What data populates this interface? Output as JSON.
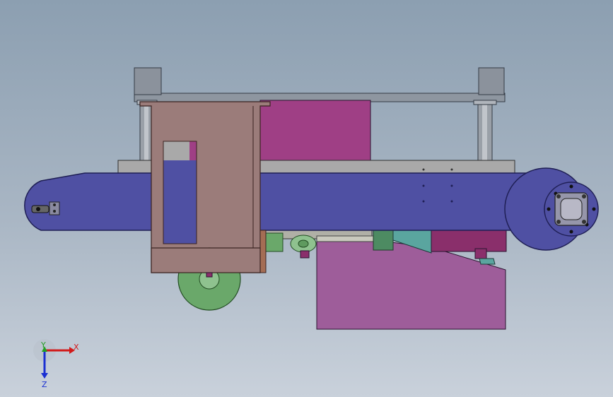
{
  "viewport": {
    "background": "#9aa9b8"
  },
  "colors": {
    "belt": "#4f50a3",
    "beltStroke": "#1f1f55",
    "bracket": "#9b7c7a",
    "panel": "#9f3f85",
    "hopper": "#9e5d9a",
    "frameGray": "#a9a9a9",
    "postGray": "#878b94",
    "wheel": "#6aa86a",
    "teal": "#5aa59f",
    "motor": "#8a2f6b"
  },
  "triad": {
    "x_label": "X",
    "y_label": "Y",
    "z_label": "Z"
  }
}
